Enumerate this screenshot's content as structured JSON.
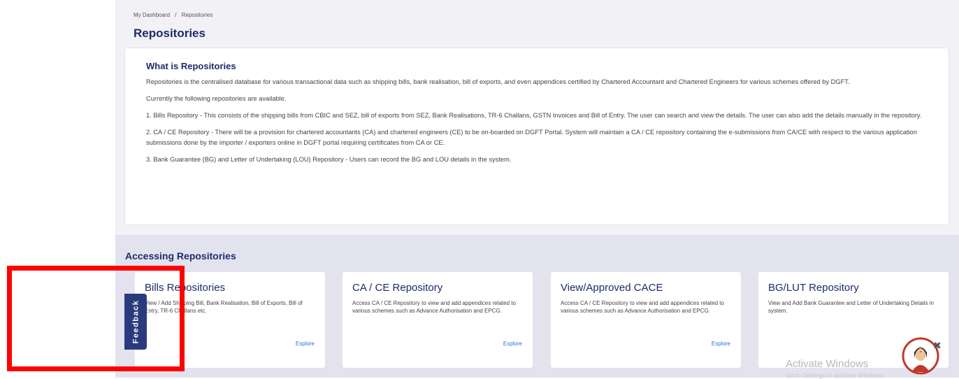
{
  "breadcrumb": {
    "home": "My Dashboard",
    "separator": "/",
    "current": "Repositories"
  },
  "page_title": "Repositories",
  "info": {
    "heading": "What is Repositories",
    "paragraphs": [
      "Repositories is the centralised database for various transactional data such as shipping bills, bank realisation, bill of exports, and even appendices certified by Chartered Accountant and Chartered Engineers for various schemes offered by DGFT.",
      "Currently the following repositories are available.",
      "1. Bills Repository - This consists of the shipping bills from CBIC and SEZ, bill of exports from SEZ, Bank Realisations, TR-6 Challans, GSTN Invoices and Bill of Entry. The user can search and view the details. The user can also add the details manually in the repository.",
      "2. CA / CE Repository - There will be a provision for chartered accountants (CA) and chartered engineers (CE) to be on-boarded on DGFT Portal. System will maintain a CA / CE repository containing the e-submissions from CA/CE with respect to the various application submissions done by the importer / exporters online in DGFT portal requiring certificates from CA or CE.",
      "3. Bank Guarantee (BG) and Letter of Undertaking (LOU) Repository - Users can record the BG and LOU details in the system."
    ]
  },
  "access": {
    "title": "Accessing Repositories",
    "tiles": [
      {
        "title": "Bills Repositories",
        "desc": "View / Add Shipping Bill, Bank Realisation, Bill of Exports, Bill of Entry, TR-6 Challans etc.",
        "link": "Explore"
      },
      {
        "title": "CA / CE Repository",
        "desc": "Access CA / CE Repository to view and add appendices related to various schemes such as Advance Authorisation and EPCG.",
        "link": "Explore"
      },
      {
        "title": "View/Approved CACE",
        "desc": "Access CA / CE Repository to view and add appendices related to various schemes such as Advance Authorisation and EPCG.",
        "link": "Explore"
      },
      {
        "title": "BG/LUT Repository",
        "desc": "View and Add Bank Guarantee and Letter of Undertaking Details in system.",
        "link": ""
      }
    ]
  },
  "feedback_label": "Feedback",
  "watermark": {
    "title": "Activate Windows",
    "subtitle": "Go to Settings to activate Windows."
  },
  "colors": {
    "brand": "#1c2b6b",
    "highlight": "#ff0000",
    "link": "#2f6fd1"
  },
  "icons": {
    "chatbot": "chatbot-avatar-icon",
    "close": "close-icon"
  }
}
